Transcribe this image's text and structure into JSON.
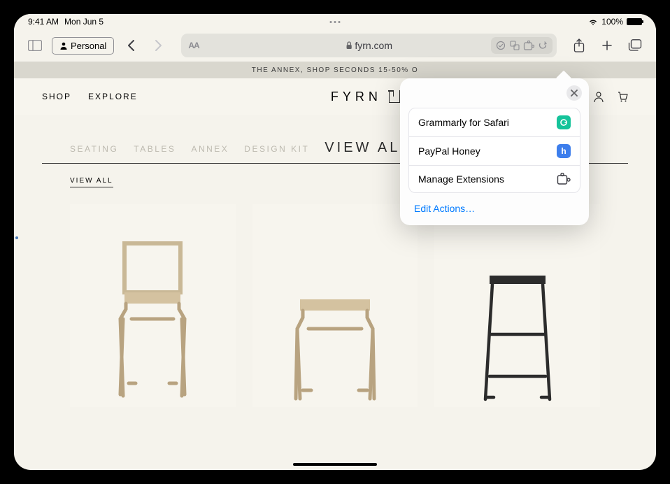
{
  "status": {
    "time": "9:41 AM",
    "date": "Mon Jun 5",
    "battery": "100%"
  },
  "safari": {
    "profile_label": "Personal",
    "reader_label": "AA",
    "url_display": "fyrn.com"
  },
  "site": {
    "promo_text": "THE ANNEX, SHOP SECONDS 15-50% O",
    "nav_shop": "SHOP",
    "nav_explore": "EXPLORE",
    "brand": "FYRN",
    "categories": {
      "seating": "SEATING",
      "tables": "TABLES",
      "annex": "ANNEX",
      "design_kit": "DESIGN KIT",
      "view_all": "VIEW ALL"
    },
    "view_all_link": "VIEW ALL"
  },
  "popover": {
    "items": [
      {
        "label": "Grammarly for Safari",
        "icon": "G",
        "icon_class": "ext-g"
      },
      {
        "label": "PayPal Honey",
        "icon": "h",
        "icon_class": "ext-h"
      },
      {
        "label": "Manage Extensions",
        "icon": "puzzle",
        "icon_class": ""
      }
    ],
    "edit_actions": "Edit Actions…"
  }
}
